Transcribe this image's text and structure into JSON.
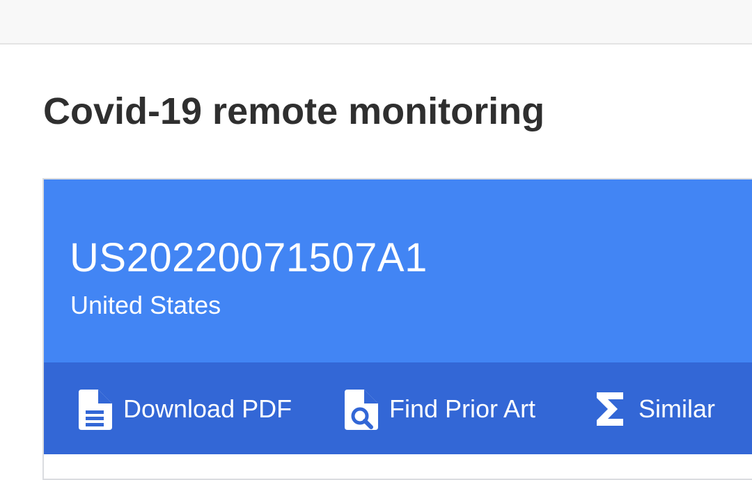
{
  "page": {
    "title": "Covid-19 remote monitoring"
  },
  "patent": {
    "publication_number": "US20220071507A1",
    "country": "United States"
  },
  "actions": {
    "download_pdf": {
      "label": "Download PDF",
      "icon": "document-icon"
    },
    "find_prior_art": {
      "label": "Find Prior Art",
      "icon": "document-search-icon"
    },
    "similar": {
      "label": "Similar",
      "icon": "sigma-icon"
    }
  },
  "colors": {
    "header": "#4285f4",
    "actions_bar": "#3367d6",
    "title_text": "#2f2f2f"
  }
}
